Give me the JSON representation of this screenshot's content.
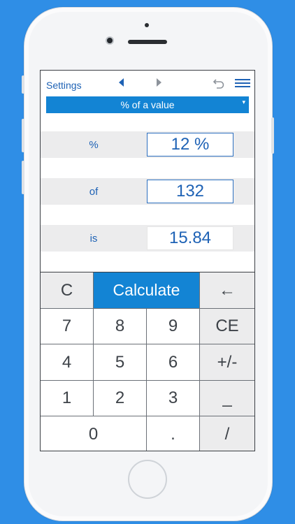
{
  "nav": {
    "settings_label": "Settings",
    "prev_icon": "triangle-left-icon",
    "next_icon": "triangle-right-icon",
    "undo_icon": "undo-icon",
    "menu_icon": "menu-icon"
  },
  "mode": {
    "selected": "% of a value",
    "caret": "▾"
  },
  "fields": {
    "percent_label": "%",
    "percent_value": "12 %",
    "of_label": "of",
    "of_value": "132",
    "is_label": "is",
    "is_value": "15.84"
  },
  "keys": {
    "clear": "C",
    "calculate": "Calculate",
    "backspace": "←",
    "k7": "7",
    "k8": "8",
    "k9": "9",
    "ce": "CE",
    "k4": "4",
    "k5": "5",
    "k6": "6",
    "sign": "+/-",
    "k1": "1",
    "k2": "2",
    "k3": "3",
    "minus": "_",
    "k0": "0",
    "dot": ".",
    "slash": "/"
  },
  "colors": {
    "background": "#2f8ee6",
    "accent": "#1384d4",
    "text_blue": "#1e62b5"
  }
}
